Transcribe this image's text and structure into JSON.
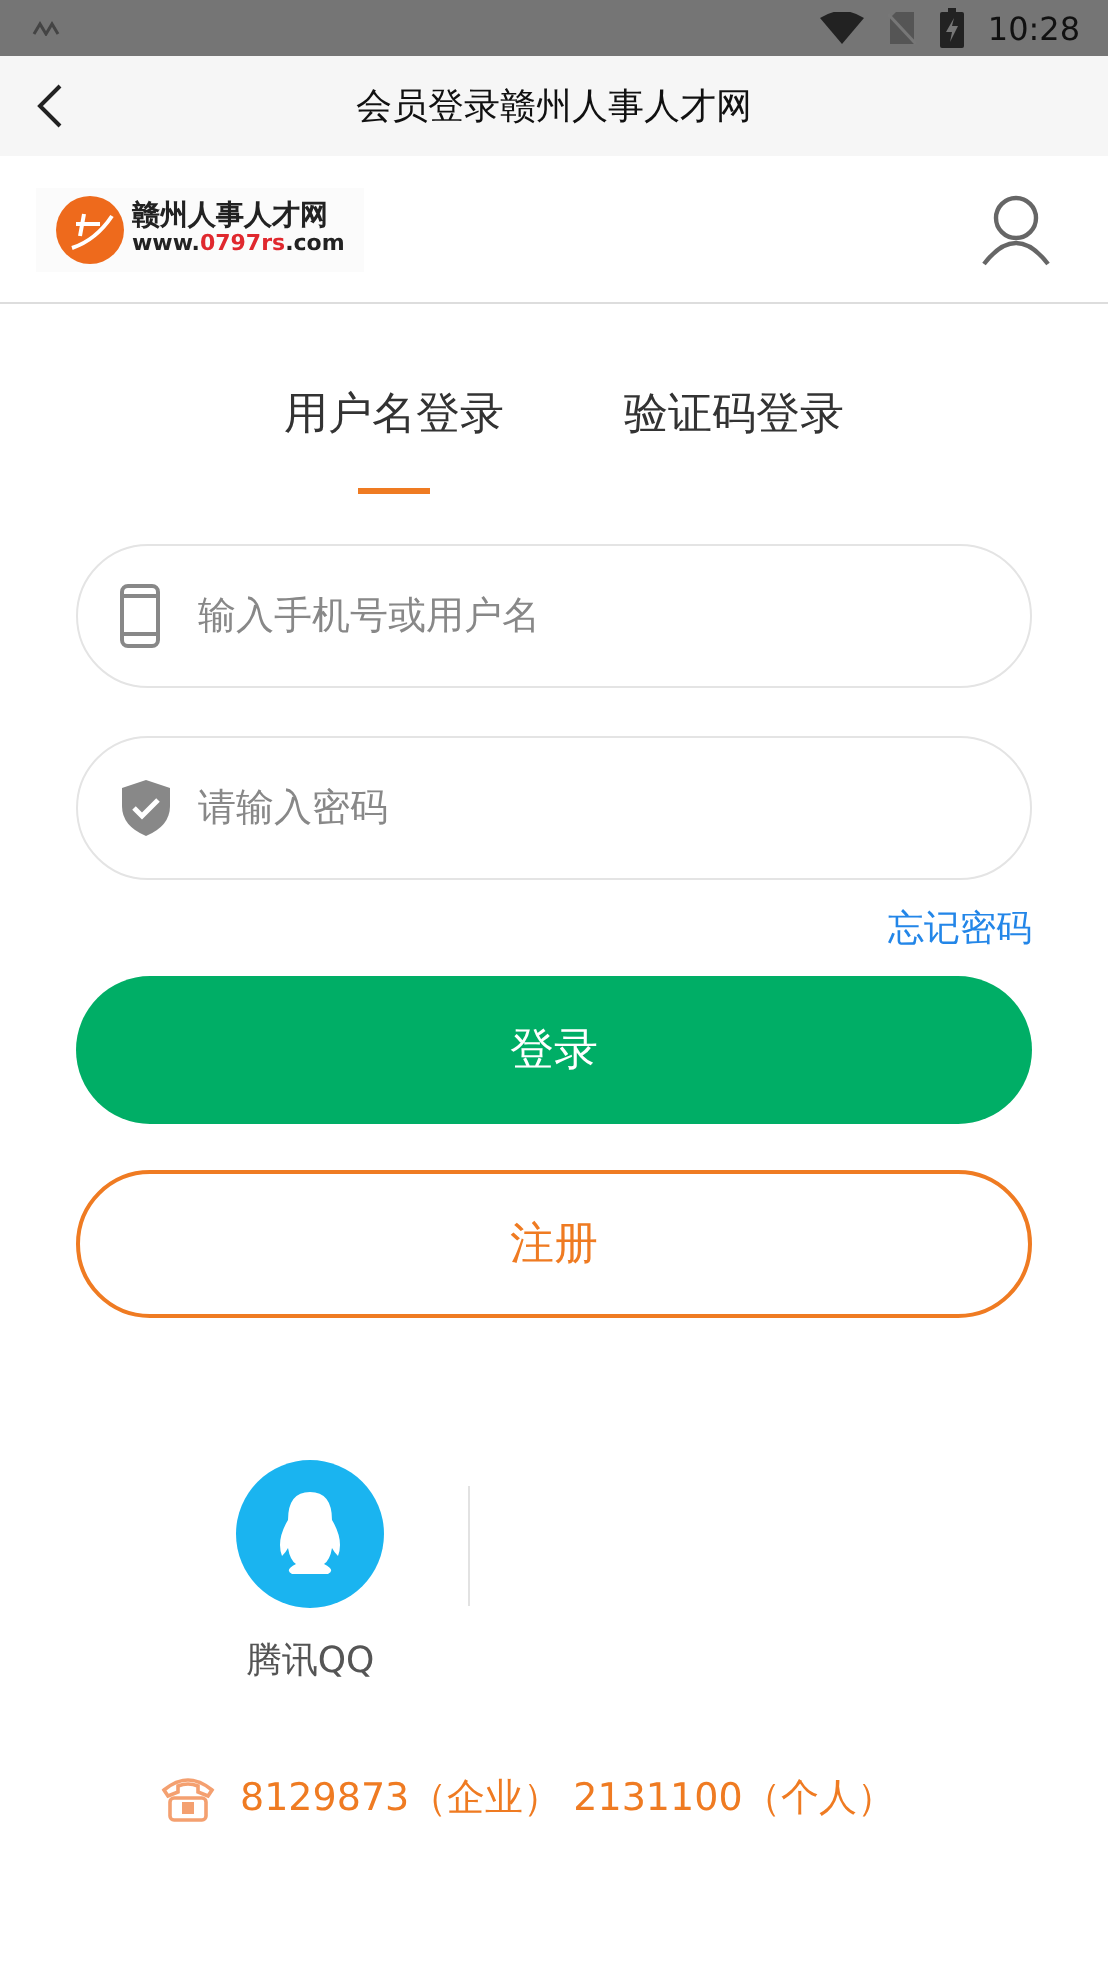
{
  "status_bar": {
    "time": "10:28"
  },
  "title_bar": {
    "title": "会员登录赣州人事人才网"
  },
  "logo": {
    "name": "赣州人事人才网",
    "url": [
      "www.",
      "0797rs",
      ".com"
    ]
  },
  "tabs": [
    {
      "label": "用户名登录",
      "selected": true
    },
    {
      "label": "验证码登录",
      "selected": false
    }
  ],
  "fields": [
    {
      "kind": "phone",
      "placeholder": "输入手机号或用户名"
    },
    {
      "kind": "password",
      "placeholder": "请输入密码"
    }
  ],
  "forgot_link": "忘记密码",
  "login_button": "登录",
  "register_button": "注册",
  "social": [
    {
      "label": "腾讯QQ"
    }
  ],
  "contact": "8129873（企业） 2131100（个人）"
}
